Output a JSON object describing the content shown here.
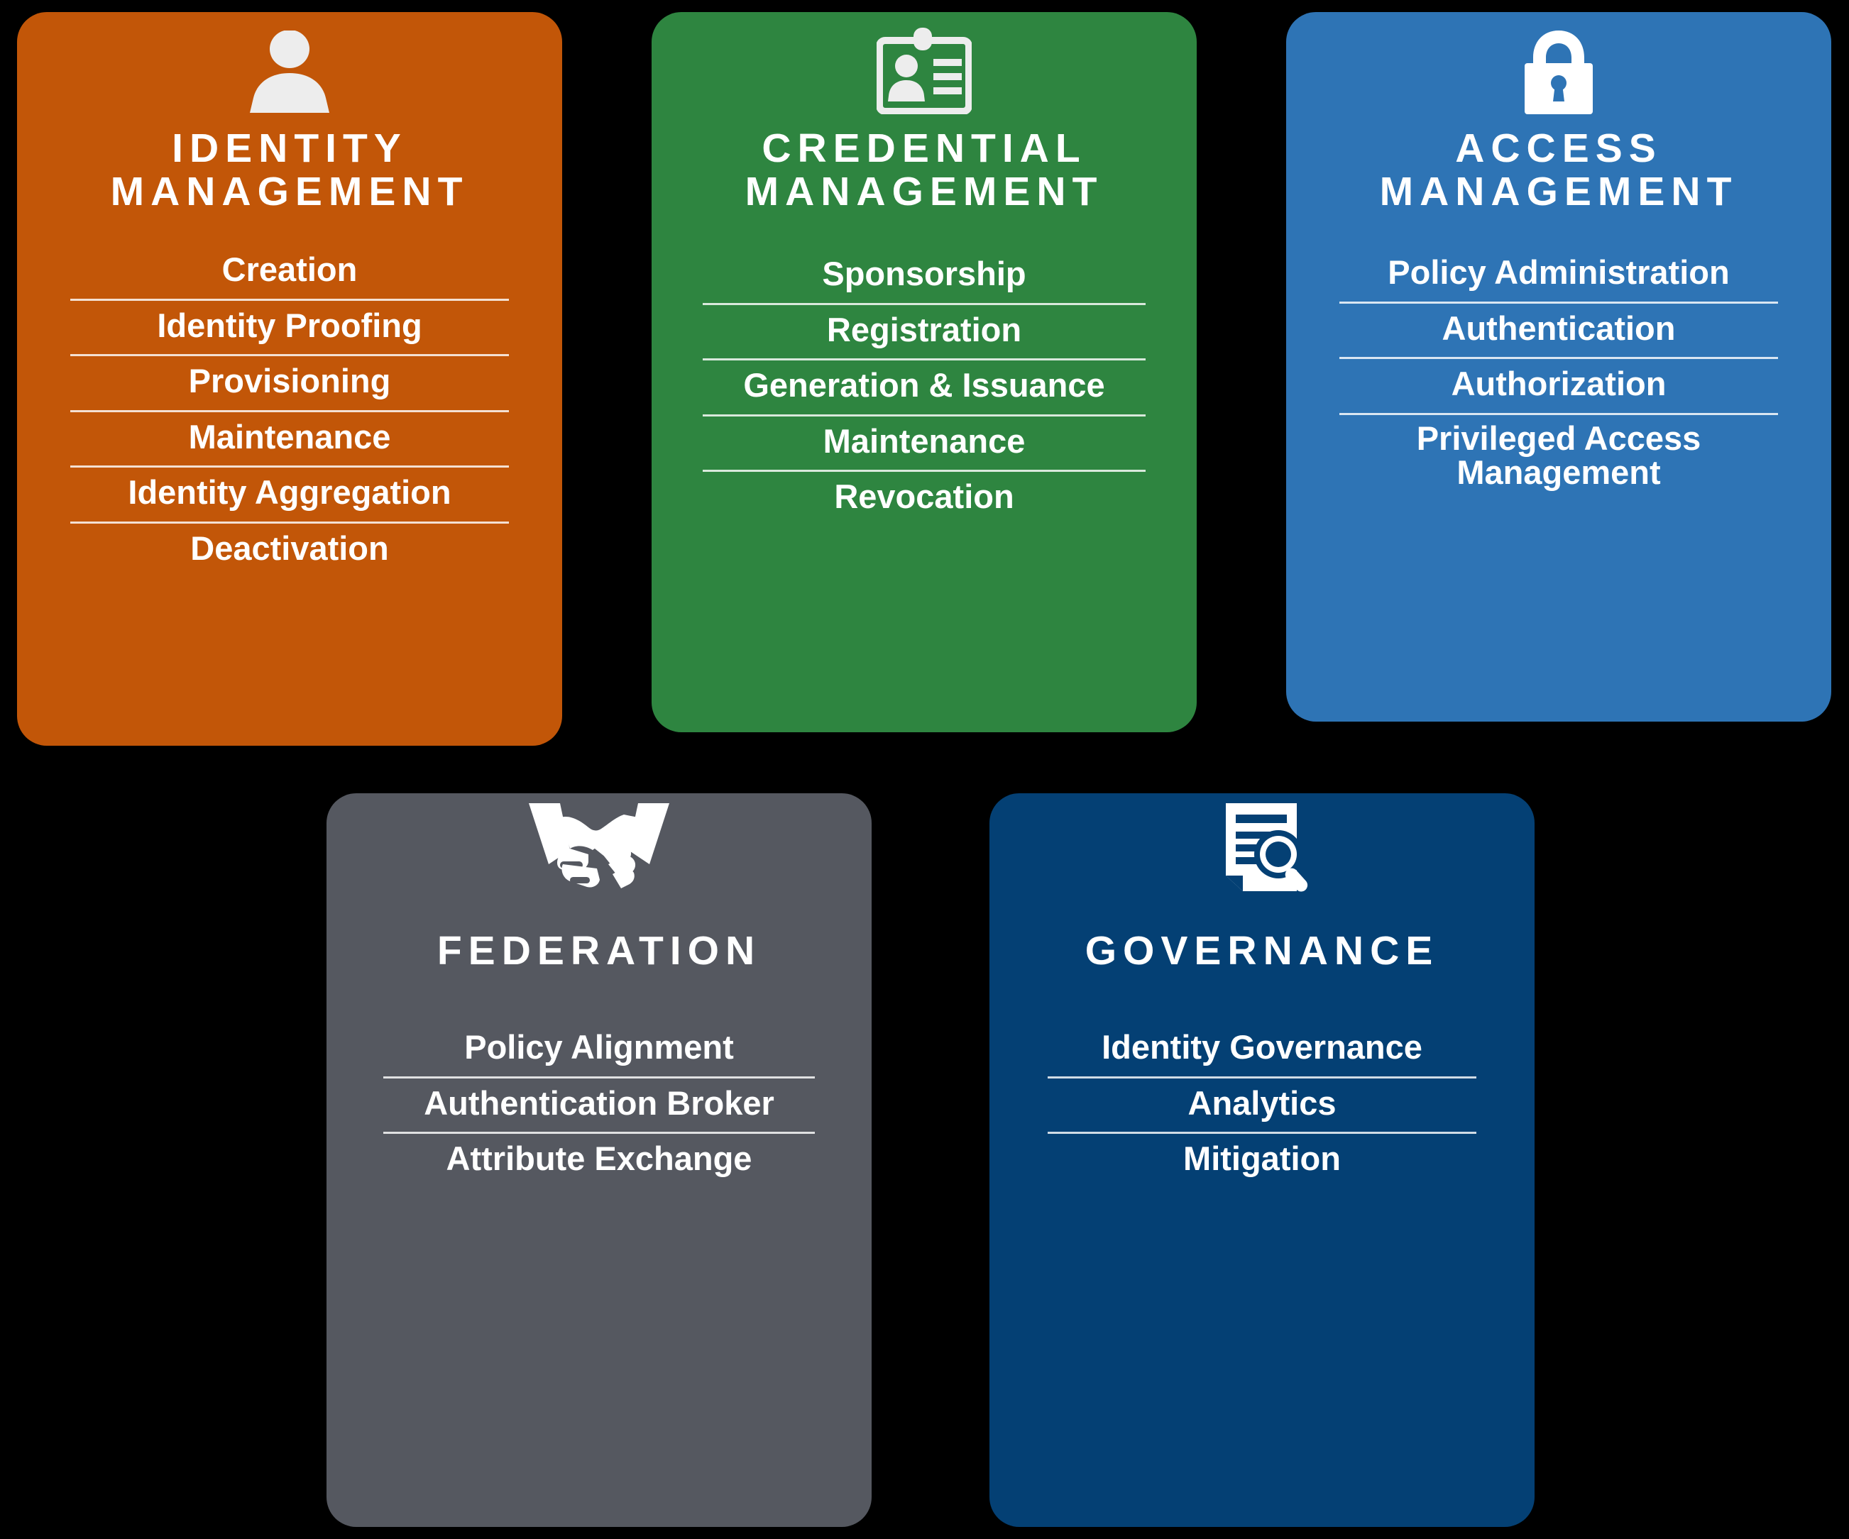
{
  "diagram": {
    "background_color": "#000000",
    "cards": [
      {
        "id": "identity-management",
        "title": "IDENTITY\nMANAGEMENT",
        "icon": "person-icon",
        "color": "#C25608",
        "items": [
          "Creation",
          "Identity Proofing",
          "Provisioning",
          "Maintenance",
          "Identity Aggregation",
          "Deactivation"
        ]
      },
      {
        "id": "credential-management",
        "title": "CREDENTIAL\nMANAGEMENT",
        "icon": "id-badge-icon",
        "color": "#2E8540",
        "items": [
          "Sponsorship",
          "Registration",
          "Generation & Issuance",
          "Maintenance",
          "Revocation"
        ]
      },
      {
        "id": "access-management",
        "title": "ACCESS\nMANAGEMENT",
        "icon": "padlock-icon",
        "color": "#2E74B5",
        "items": [
          "Policy Administration",
          "Authentication",
          "Authorization",
          "Privileged Access\nManagement"
        ]
      },
      {
        "id": "federation",
        "title": "FEDERATION",
        "icon": "handshake-icon",
        "color": "#555860",
        "items": [
          "Policy Alignment",
          "Authentication Broker",
          "Attribute Exchange"
        ]
      },
      {
        "id": "governance",
        "title": "GOVERNANCE",
        "icon": "document-search-icon",
        "color": "#044074",
        "items": [
          "Identity Governance",
          "Analytics",
          "Mitigation"
        ]
      }
    ]
  }
}
